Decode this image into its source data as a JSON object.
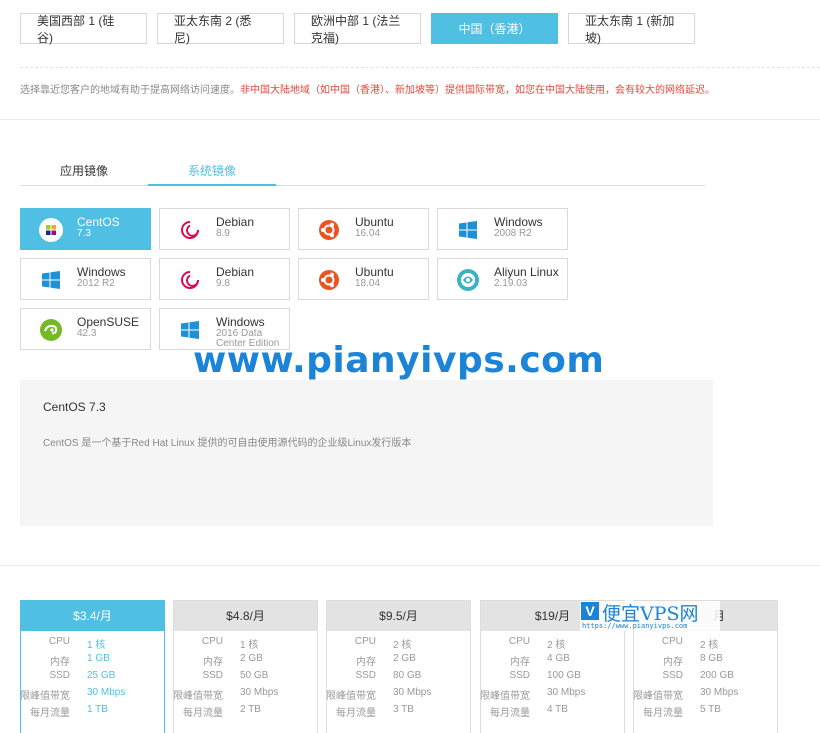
{
  "regions": [
    {
      "label": "美国西部 1 (硅谷)"
    },
    {
      "label": "亚太东南 2 (悉尼)"
    },
    {
      "label": "欧洲中部 1 (法兰克福)"
    },
    {
      "label": "中国（香港）",
      "active": true
    },
    {
      "label": "亚太东南 1 (新加坡)"
    }
  ],
  "region_note": {
    "plain": "选择靠近您客户的地域有助于提高网络访问速度。",
    "warning": "非中国大陆地域（如中国（香港）、新加坡等）提供国际带宽，如您在中国大陆使用，会有较大的网络延迟。"
  },
  "image_tabs": [
    {
      "label": "应用镜像"
    },
    {
      "label": "系统镜像",
      "active": true
    }
  ],
  "os_images": [
    {
      "name": "CentOS",
      "version": "7.3",
      "icon": "centos-icon",
      "active": true
    },
    {
      "name": "Debian",
      "version": "8.9",
      "icon": "debian-icon"
    },
    {
      "name": "Ubuntu",
      "version": "16.04",
      "icon": "ubuntu-icon"
    },
    {
      "name": "Windows",
      "version": "2008 R2",
      "icon": "windows-icon"
    },
    {
      "name": "Windows",
      "version": "2012 R2",
      "icon": "windows-icon"
    },
    {
      "name": "Debian",
      "version": "9.8",
      "icon": "debian-icon"
    },
    {
      "name": "Ubuntu",
      "version": "18.04",
      "icon": "ubuntu-icon"
    },
    {
      "name": "Aliyun Linux",
      "version": "2.19.03",
      "icon": "aliyun-linux-icon"
    },
    {
      "name": "OpenSUSE",
      "version": "42.3",
      "icon": "opensuse-icon"
    },
    {
      "name": "Windows",
      "version": "2016 Data Center Edition",
      "icon": "windows-icon"
    }
  ],
  "watermark": "www.pianyivps.com",
  "selected_image": {
    "title": "CentOS 7.3",
    "description": "CentOS 是一个基于Red Hat Linux 提供的可自由使用源代码的企业级Linux发行版本"
  },
  "spec_labels": {
    "cpu": "CPU",
    "memory": "内存",
    "ssd": "SSD",
    "bandwidth": "限峰值带宽",
    "traffic": "每月流量"
  },
  "plans": [
    {
      "price": "$3.4/月",
      "cpu": "1 核",
      "memory": "1 GB",
      "ssd": "25 GB",
      "bandwidth": "30 Mbps",
      "traffic": "1 TB",
      "active": true
    },
    {
      "price": "$4.8/月",
      "cpu": "1 核",
      "memory": "2 GB",
      "ssd": "50 GB",
      "bandwidth": "30 Mbps",
      "traffic": "2 TB"
    },
    {
      "price": "$9.5/月",
      "cpu": "2 核",
      "memory": "2 GB",
      "ssd": "80 GB",
      "bandwidth": "30 Mbps",
      "traffic": "3 TB"
    },
    {
      "price": "$19/月",
      "cpu": "2 核",
      "memory": "4 GB",
      "ssd": "100 GB",
      "bandwidth": "30 Mbps",
      "traffic": "4 TB"
    },
    {
      "price": "月",
      "cpu": "2 核",
      "memory": "8 GB",
      "ssd": "200 GB",
      "bandwidth": "30 Mbps",
      "traffic": "5 TB"
    }
  ],
  "logo_watermark": {
    "mark": "V",
    "text": "便宜VPS网",
    "url": "https://www.pianyivps.com"
  },
  "colors": {
    "accent": "#4fc0e3",
    "warning": "#e24a3b",
    "watermark": "#1b84d6"
  }
}
